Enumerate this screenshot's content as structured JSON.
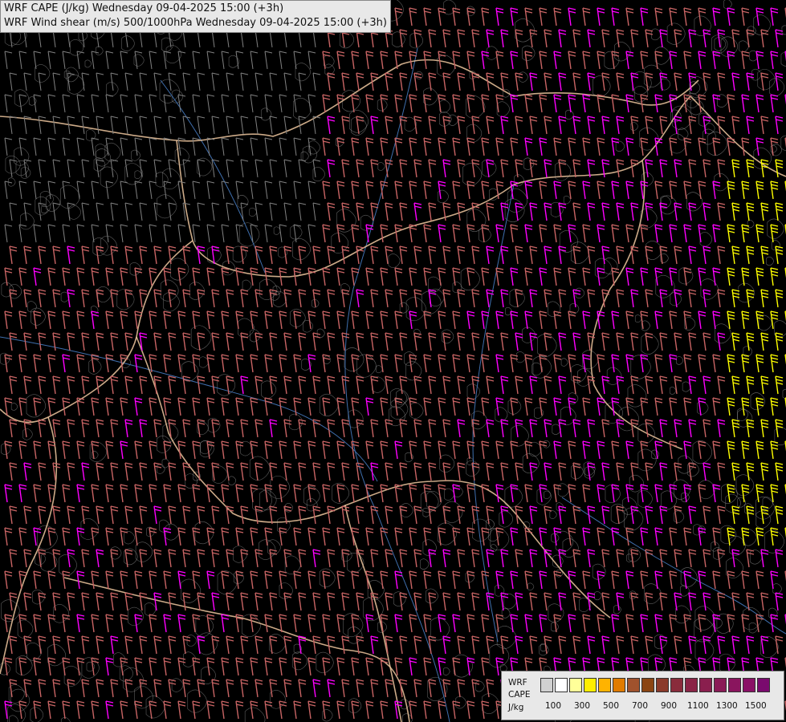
{
  "titles": {
    "line1": "WRF CAPE (J/kg) Wednesday 09-04-2025 15:00 (+3h)",
    "line2": "WRF Wind shear (m/s) 500/1000hPa Wednesday 09-04-2025 15:00 (+3h)"
  },
  "legend": {
    "model": "WRF",
    "field": "CAPE",
    "unit": "J/kg",
    "swatch_colors": [
      "#d0d0d0",
      "#ffffff",
      "#ffff99",
      "#ffee00",
      "#ffb300",
      "#e07b00",
      "#a0522d",
      "#8b4513",
      "#8b3a2a",
      "#8a2c3c",
      "#8a2446",
      "#8a1f4e",
      "#8a1a56",
      "#8a155e",
      "#8a1066",
      "#7a0a6e"
    ],
    "ticks": [
      "100",
      "300",
      "500",
      "700",
      "900",
      "1100",
      "1300",
      "1500"
    ]
  },
  "colors": {
    "background": "#000000",
    "border": "#f0c8a0",
    "river": "#3f6fae",
    "contour": "#a8a8a8",
    "barb_weak": "#808080",
    "barb_mid": "#c86464",
    "barb_strong": "#ff00ff",
    "barb_extreme": "#ffff00"
  },
  "icons": {
    "wind_barb": "wind-barb-icon"
  }
}
